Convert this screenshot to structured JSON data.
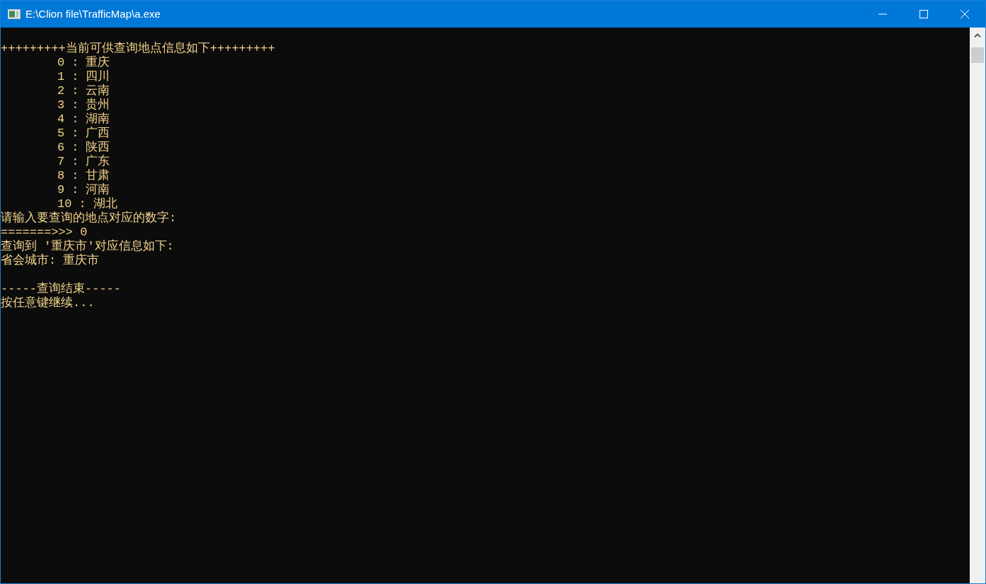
{
  "window": {
    "title": "E:\\Clion file\\TrafficMap\\a.exe"
  },
  "console": {
    "header": "+++++++++当前可供查询地点信息如下+++++++++",
    "places": [
      {
        "index": "0",
        "separator": ":",
        "name": "重庆"
      },
      {
        "index": "1",
        "separator": ":",
        "name": "四川"
      },
      {
        "index": "2",
        "separator": ":",
        "name": "云南"
      },
      {
        "index": "3",
        "separator": ":",
        "name": "贵州"
      },
      {
        "index": "4",
        "separator": ":",
        "name": "湖南"
      },
      {
        "index": "5",
        "separator": ":",
        "name": "广西"
      },
      {
        "index": "6",
        "separator": ":",
        "name": "陕西"
      },
      {
        "index": "7",
        "separator": ":",
        "name": "广东"
      },
      {
        "index": "8",
        "separator": ":",
        "name": "甘肃"
      },
      {
        "index": "9",
        "separator": ":",
        "name": "河南"
      },
      {
        "index": "10",
        "separator": ":",
        "name": "湖北"
      }
    ],
    "after": [
      {
        "kind": "text",
        "text": "请输入要查询的地点对应的数字:"
      },
      {
        "kind": "text",
        "text": "=======>>> 0"
      },
      {
        "kind": "text",
        "text": "查询到 '重庆市'对应信息如下:"
      },
      {
        "kind": "text",
        "text": "省会城市: 重庆市"
      },
      {
        "kind": "blank"
      },
      {
        "kind": "text",
        "text": "-----查询结束-----"
      },
      {
        "kind": "text",
        "text": "按任意键继续..."
      }
    ]
  }
}
